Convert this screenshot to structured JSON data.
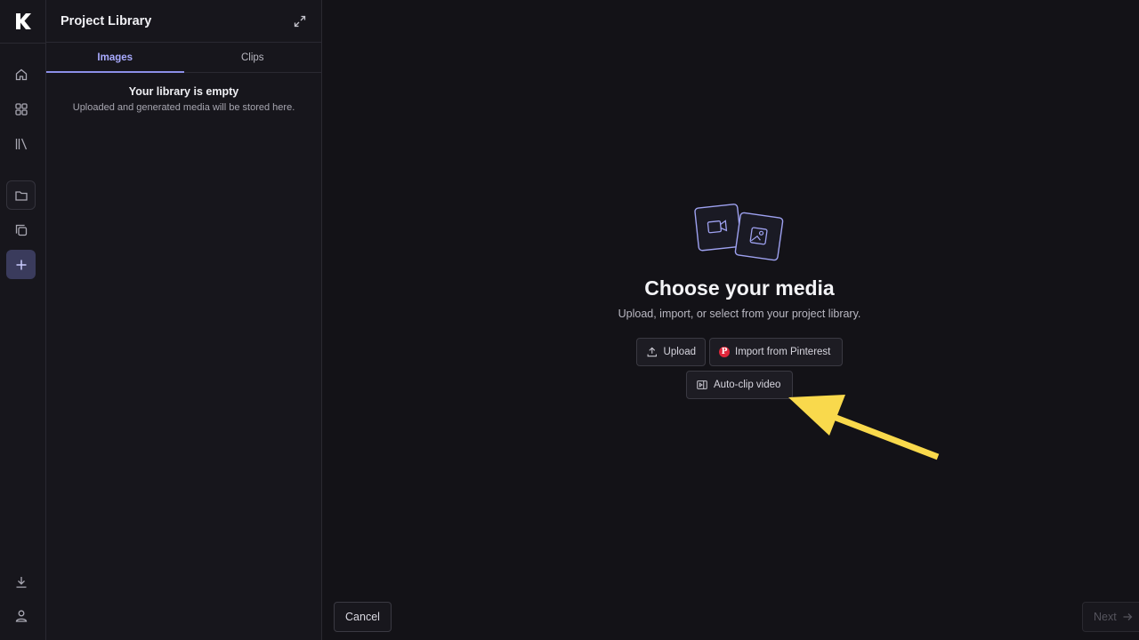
{
  "app": {
    "logo_letter": "K"
  },
  "rail": {
    "items": [
      {
        "name": "home",
        "icon": "home-icon"
      },
      {
        "name": "apps",
        "icon": "grid-icon"
      },
      {
        "name": "library",
        "icon": "library-icon"
      },
      {
        "name": "folder",
        "icon": "folder-icon"
      },
      {
        "name": "layers",
        "icon": "copy-icon"
      },
      {
        "name": "create",
        "icon": "plus-icon"
      },
      {
        "name": "download",
        "icon": "download-icon"
      },
      {
        "name": "account",
        "icon": "user-icon"
      }
    ]
  },
  "library": {
    "title": "Project Library",
    "tabs": [
      {
        "label": "Images",
        "active": true
      },
      {
        "label": "Clips",
        "active": false
      }
    ],
    "empty_title": "Your library is empty",
    "empty_subtitle": "Uploaded and generated media will be stored here."
  },
  "main": {
    "title": "Choose your media",
    "subtitle": "Upload, import, or select from your project library.",
    "upload_label": "Upload",
    "pinterest_label": "Import from Pinterest",
    "pinterest_glyph": "P",
    "autoclip_label": "Auto-clip video",
    "cancel_label": "Cancel",
    "next_label": "Next"
  },
  "colors": {
    "accent": "#8c8fe8",
    "annotation_arrow": "#f9d94c",
    "pinterest": "#e0263a"
  }
}
